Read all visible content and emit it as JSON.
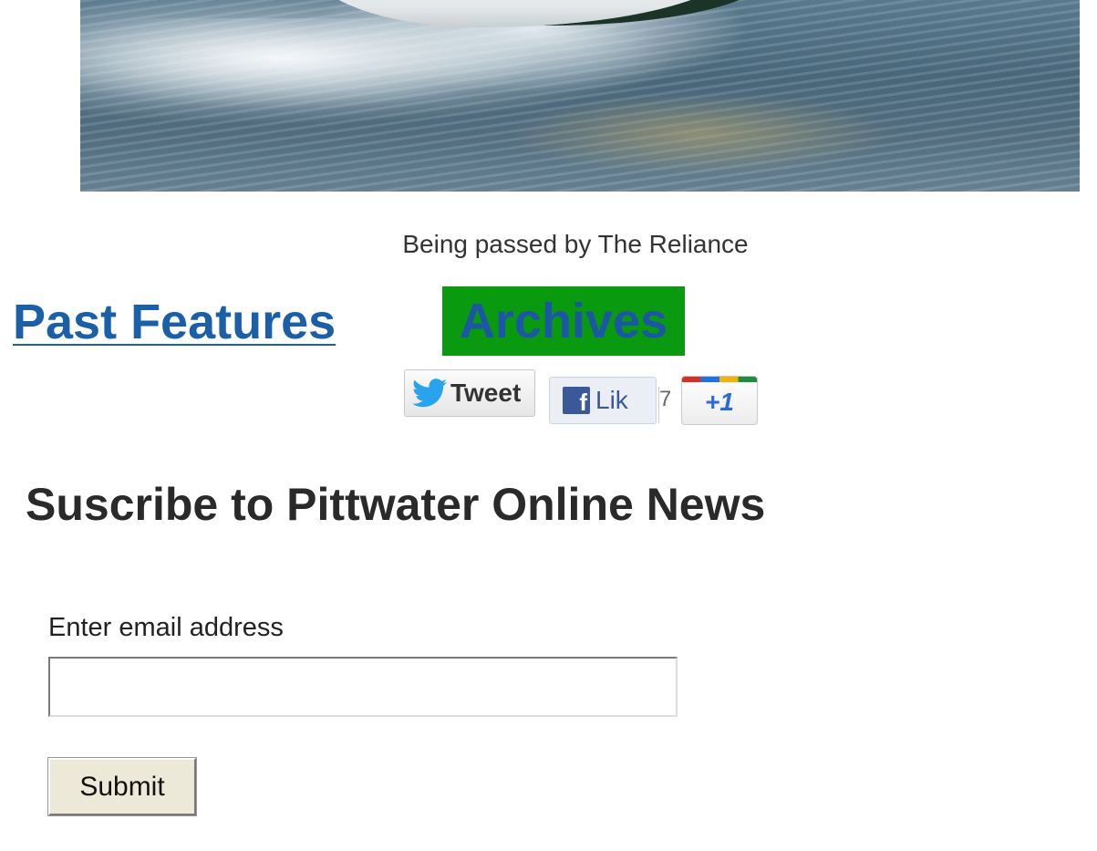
{
  "photo": {
    "caption": "Being passed by The Reliance"
  },
  "nav": {
    "past_features": "Past Features",
    "archives": "Archives"
  },
  "social": {
    "tweet_label": "Tweet",
    "like_label": "Lik",
    "like_count": "7",
    "plusone_label": "+1"
  },
  "subscribe": {
    "title": "Suscribe to Pittwater Online News",
    "email_label": "Enter email address",
    "email_value": "",
    "submit_label": "Submit"
  },
  "colors": {
    "link_blue": "#1a5fa8",
    "archives_bg": "#0a9a10",
    "facebook_blue": "#3b5998"
  }
}
